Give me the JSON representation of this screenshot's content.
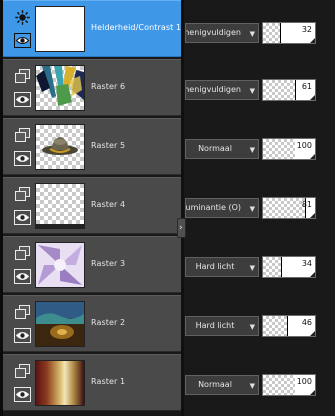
{
  "layers": [
    {
      "name": "Helderheid/Contrast 1",
      "blend": "Vermenigvuldigen",
      "opacity": 32,
      "selected": true,
      "type": "adjustment",
      "thumb": "white"
    },
    {
      "name": "Raster 6",
      "blend": "Vermenigvuldigen",
      "opacity": 61,
      "selected": false,
      "type": "raster",
      "thumb": "feathers"
    },
    {
      "name": "Raster 5",
      "blend": "Normaal",
      "opacity": 100,
      "selected": false,
      "type": "raster",
      "thumb": "hat"
    },
    {
      "name": "Raster 4",
      "blend": "Luminantie (O)",
      "opacity": 81,
      "selected": false,
      "type": "raster",
      "thumb": "empty"
    },
    {
      "name": "Raster 3",
      "blend": "Hard licht",
      "opacity": 34,
      "selected": false,
      "type": "raster",
      "thumb": "pinwheel"
    },
    {
      "name": "Raster 2",
      "blend": "Hard licht",
      "opacity": 46,
      "selected": false,
      "type": "raster",
      "thumb": "landscape"
    },
    {
      "name": "Raster 1",
      "blend": "Normaal",
      "opacity": 100,
      "selected": false,
      "type": "raster",
      "thumb": "gradient"
    }
  ],
  "colors": {
    "panel_bg": "#191919",
    "row_bg": "#4a4a4a",
    "selected_bg": "#3f97e8",
    "text": "#e4e4e4"
  },
  "icons": {
    "adjustment_layer": "sun-icon",
    "raster_layer": "raster-layer-icon",
    "visibility": "eye-icon",
    "dropdown": "chevron-down-icon",
    "splitter": "chevron-right-icon"
  },
  "splitter_glyph": "›"
}
